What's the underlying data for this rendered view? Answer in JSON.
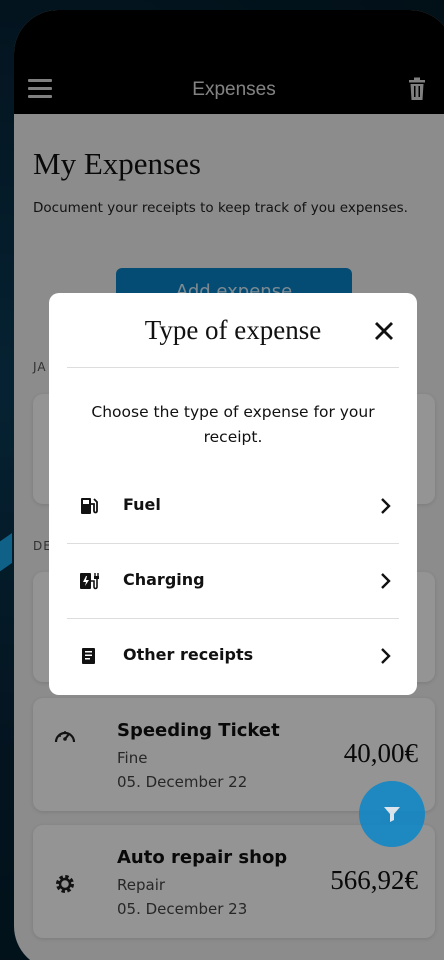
{
  "header": {
    "title": "Expenses",
    "menu_icon": "hamburger-menu-icon",
    "trash_icon": "trash-icon"
  },
  "page": {
    "title": "My Expenses",
    "subtitle": "Document your receipts to keep track of you expenses.",
    "add_button_label": "Add expense"
  },
  "sections": {
    "jan_label": "JA",
    "dec_label": "DE"
  },
  "expenses": [
    {
      "icon": "speedometer-icon",
      "name": "Speeding Ticket",
      "category": "Fine",
      "date": "05. December 22",
      "amount": "40,00€"
    },
    {
      "icon": "gear-icon",
      "name": "Auto repair shop",
      "category": "Repair",
      "date": "05. December 23",
      "amount": "566,92€"
    }
  ],
  "modal": {
    "title": "Type of expense",
    "description": "Choose the type of expense for your receipt.",
    "options": [
      {
        "label": "Fuel",
        "icon": "fuel-pump-icon"
      },
      {
        "label": "Charging",
        "icon": "ev-charging-icon"
      },
      {
        "label": "Other receipts",
        "icon": "receipt-icon"
      }
    ]
  },
  "colors": {
    "accent": "#0a84c9",
    "topbar": "#000000",
    "background": "#f1f1f1"
  }
}
